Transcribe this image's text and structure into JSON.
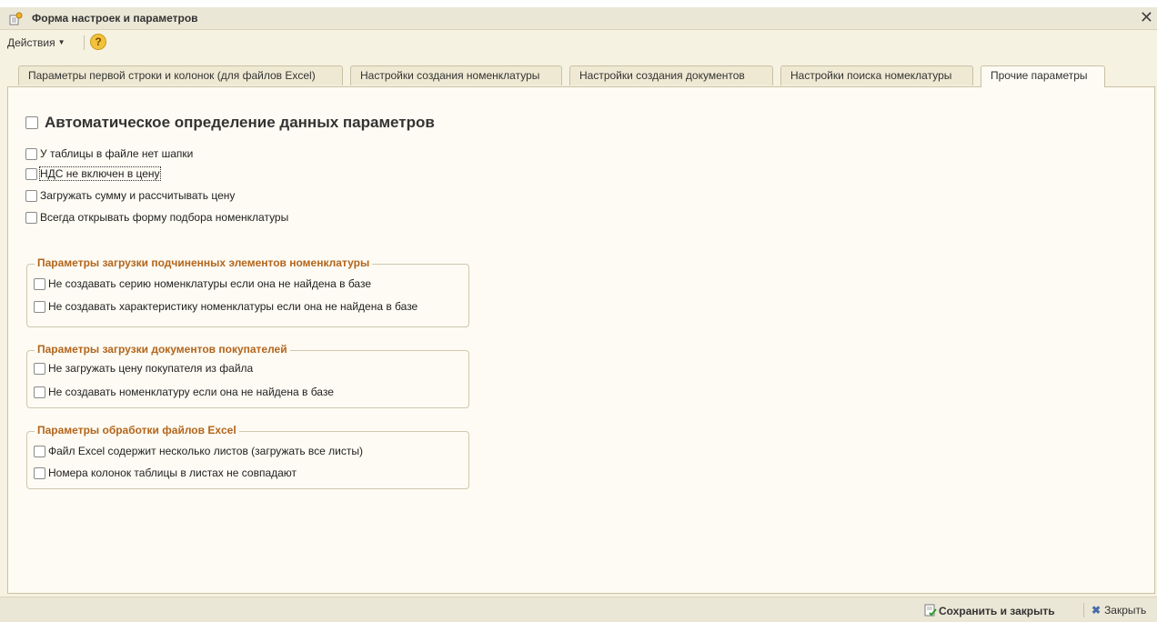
{
  "window": {
    "title": "Форма настроек и параметров",
    "close_glyph": "✕"
  },
  "menu": {
    "actions_label": "Действия",
    "help_glyph": "?"
  },
  "tabs": [
    {
      "label": "Параметры первой строки и колонок (для файлов Excel)",
      "active": false
    },
    {
      "label": "Настройки создания номенклатуры",
      "active": false
    },
    {
      "label": "Настройки создания документов",
      "active": false
    },
    {
      "label": "Настройки поиска номеклатуры",
      "active": false
    },
    {
      "label": "Прочие параметры",
      "active": true
    }
  ],
  "main": {
    "auto_label": "Автоматическое определение данных параметров",
    "options": [
      {
        "label": "У таблицы в файле нет шапки",
        "checked": false
      },
      {
        "label": "НДС не включен в цену",
        "checked": false
      },
      {
        "label": "Загружать сумму и рассчитывать цену",
        "checked": false
      },
      {
        "label": "Всегда открывать форму подбора номенклатуры",
        "checked": false
      }
    ]
  },
  "groups": [
    {
      "title": "Параметры загрузки подчиненных элементов номенклатуры",
      "options": [
        {
          "label": "Не создавать серию номенклатуры если она не найдена в базе",
          "checked": false
        },
        {
          "label": "Не создавать характеристику номенклатуры если она не найдена в базе",
          "checked": false
        }
      ]
    },
    {
      "title": "Параметры загрузки документов покупателей",
      "options": [
        {
          "label": "Не загружать цену покупателя из файла",
          "checked": false
        },
        {
          "label": "Не создавать номенклатуру если она не найдена в базе",
          "checked": false
        }
      ]
    },
    {
      "title": "Параметры обработки файлов Excel",
      "options": [
        {
          "label": "Файл Excel содержит несколько листов (загружать все листы)",
          "checked": false
        },
        {
          "label": "Номера колонок таблицы в листах не совпадают",
          "checked": false
        }
      ]
    }
  ],
  "footer": {
    "save_label": "Сохранить и закрыть",
    "close_label": "Закрыть",
    "close_glyph": "✖"
  },
  "colors": {
    "background": "#f6f2e2",
    "panel": "#fdfbf3",
    "group_title": "#b3651c"
  }
}
